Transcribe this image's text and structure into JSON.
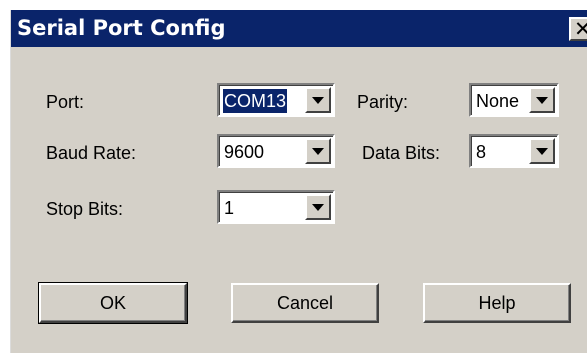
{
  "window": {
    "title": "Serial Port Config",
    "close_glyph": "✕",
    "close_icon": "close-icon"
  },
  "fields": {
    "port": {
      "label": "Port:",
      "value": "COM13"
    },
    "parity": {
      "label": "Parity:",
      "value": "None"
    },
    "baud_rate": {
      "label": "Baud Rate:",
      "value": "9600"
    },
    "data_bits": {
      "label": "Data Bits:",
      "value": "8"
    },
    "stop_bits": {
      "label": "Stop Bits:",
      "value": "1"
    }
  },
  "buttons": {
    "ok": "OK",
    "cancel": "Cancel",
    "help": "Help"
  },
  "colors": {
    "title_bar": "#0a246a",
    "dialog_face": "#d4d0c8",
    "selection": "#0a246a"
  }
}
